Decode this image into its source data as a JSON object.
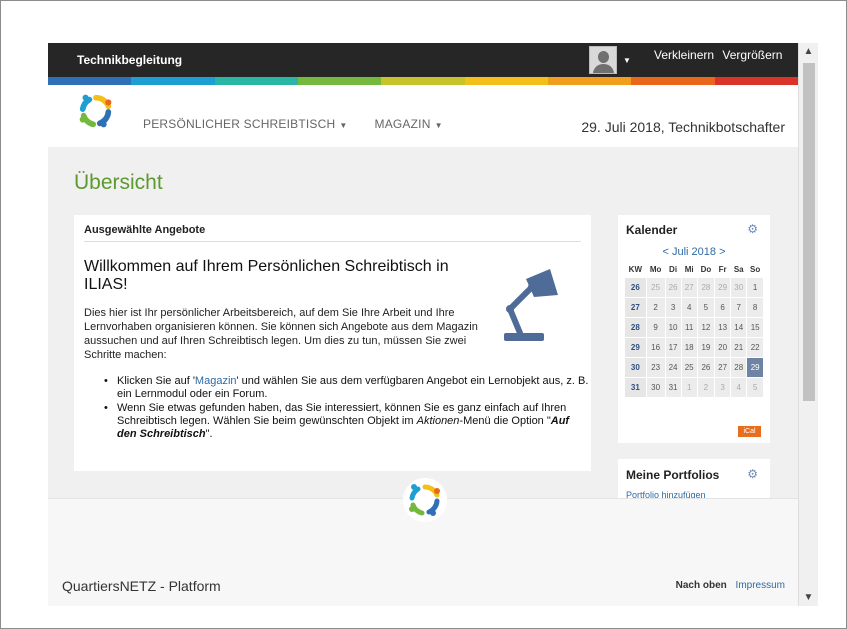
{
  "topbar": {
    "title": "Technikbegleitung",
    "zoom_out": "Verkleinern",
    "zoom_in": "Vergrößern"
  },
  "nav": {
    "items": [
      {
        "label": "PERSÖNLICHER SCHREIBTISCH"
      },
      {
        "label": "MAGAZIN"
      }
    ]
  },
  "header": {
    "date_user": "29. Juli 2018, Technikbotschafter"
  },
  "page": {
    "title": "Übersicht"
  },
  "main_panel": {
    "header": "Ausgewählte Angebote",
    "welcome": "Willkommen auf Ihrem Persönlichen Schreibtisch in ILIAS!",
    "intro": "Dies hier ist Ihr persönlicher Arbeitsbereich, auf dem Sie Ihre Arbeit und Ihre Lernvorhaben organisieren können. Sie können sich Angebote aus dem Magazin aussuchen und auf Ihren Schreibtisch legen. Um dies zu tun, müssen Sie zwei Schritte machen:",
    "bullet1": {
      "pre": "Klicken Sie auf '",
      "link": "Magazin",
      "post": "' und wählen Sie aus dem verfügbaren Angebot ein Lernobjekt aus, z. B. ein Lernmodul oder ein Forum."
    },
    "bullet2": {
      "pre": "Wenn Sie etwas gefunden haben, das Sie interessiert, können Sie es ganz einfach auf Ihren Schreibtisch legen. Wählen Sie beim gewünschten Objekt im ",
      "em1": "Aktionen",
      "mid": "-Menü die Option \"",
      "em2": "Auf den Schreibtisch",
      "post": "\"."
    }
  },
  "calendar": {
    "title": "Kalender",
    "prev": "<",
    "month": "Juli 2018",
    "next": ">",
    "weekdays": [
      "KW",
      "Mo",
      "Di",
      "Mi",
      "Do",
      "Fr",
      "Sa",
      "So"
    ],
    "weeks": [
      [
        "26",
        "25",
        "26",
        "27",
        "28",
        "29",
        "30",
        "1"
      ],
      [
        "27",
        "2",
        "3",
        "4",
        "5",
        "6",
        "7",
        "8"
      ],
      [
        "28",
        "9",
        "10",
        "11",
        "12",
        "13",
        "14",
        "15"
      ],
      [
        "29",
        "16",
        "17",
        "18",
        "19",
        "20",
        "21",
        "22"
      ],
      [
        "30",
        "23",
        "24",
        "25",
        "26",
        "27",
        "28",
        "29"
      ],
      [
        "31",
        "30",
        "31",
        "1",
        "2",
        "3",
        "4",
        "5"
      ]
    ],
    "ical": "iCal"
  },
  "portfolios": {
    "title": "Meine Portfolios",
    "link": "Portfolio hinzufügen"
  },
  "footer": {
    "brand": "QuartiersNETZ - Platform",
    "to_top": "Nach oben",
    "imprint": "Impressum"
  },
  "colors": {
    "accent_green": "#5c9a2d",
    "link_blue": "#2e6aa6",
    "ical_orange": "#e76e1e",
    "rainbow": [
      "#2f70b6",
      "#1e9fd4",
      "#29b6a5",
      "#74b83e",
      "#c6c32b",
      "#f3c01a",
      "#f19e1c",
      "#e9661d",
      "#d9332a"
    ]
  }
}
